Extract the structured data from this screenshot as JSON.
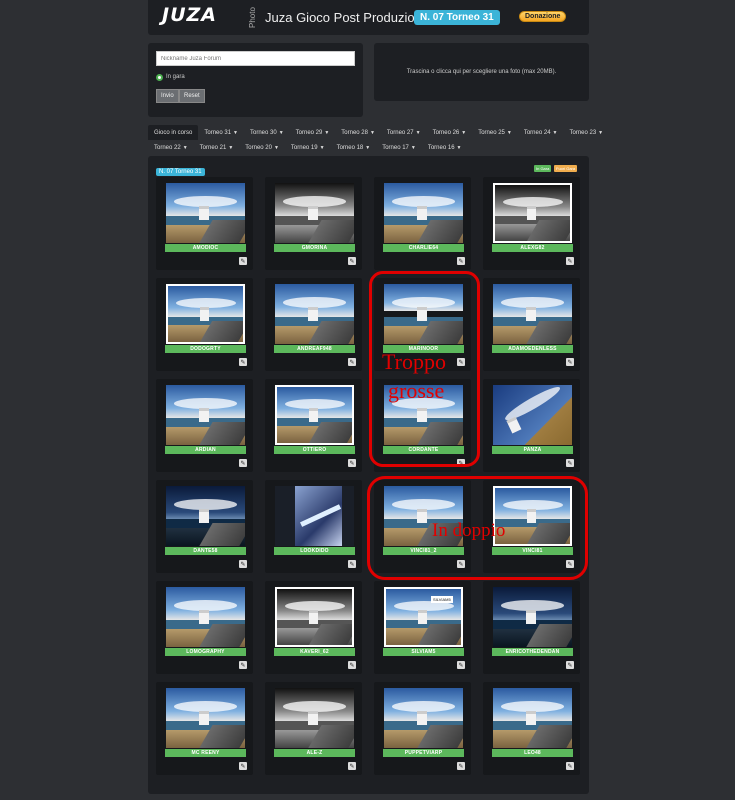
{
  "header": {
    "logo": "JUZA",
    "logo_sub": "Photo",
    "title": "Juza Gioco Post Produzione",
    "badge": "N. 07 Torneo 31",
    "donate": "Donazione"
  },
  "form": {
    "nickname_placeholder": "Nickname Juza Forum",
    "radio_label": "In gara",
    "send_label": "Invio",
    "reset_label": "Reset"
  },
  "upload": {
    "text": "Trascina o clicca qui per scegliere una foto (max 20MB)."
  },
  "tabs_row1": [
    "Gioco in corso",
    "Torneo 31",
    "Torneo 30",
    "Torneo 29",
    "Torneo 28",
    "Torneo 27",
    "Torneo 26",
    "Torneo 25",
    "Torneo 24",
    "Torneo 23"
  ],
  "tabs_row2": [
    "Torneo 22",
    "Torneo 21",
    "Torneo 20",
    "Torneo 19",
    "Torneo 18",
    "Torneo 17",
    "Torneo 16"
  ],
  "grid": {
    "badge": "N. 07 Torneo 31",
    "legend_in_gara": "In Gara",
    "legend_fuori_gara": "Fuori Gara"
  },
  "entries": [
    {
      "name": "AMODIOC",
      "style": "color"
    },
    {
      "name": "GMORINA",
      "style": "bw"
    },
    {
      "name": "CHARLIE64",
      "style": "color"
    },
    {
      "name": "ALEXG82",
      "style": "bw framed"
    },
    {
      "name": "DODOGRTY",
      "style": "color framed"
    },
    {
      "name": "ANDREAF948",
      "style": "color"
    },
    {
      "name": "MARINOOR",
      "style": "color pano"
    },
    {
      "name": "ADAMOEDENLESS",
      "style": "color"
    },
    {
      "name": "ARDIAN",
      "style": "color"
    },
    {
      "name": "OTTIERO",
      "style": "color framed"
    },
    {
      "name": "CORDANTE",
      "style": "color"
    },
    {
      "name": "PANZA",
      "style": "tilt"
    },
    {
      "name": "DANTE58",
      "style": "dark"
    },
    {
      "name": "LOOKDIDO",
      "style": "abstract"
    },
    {
      "name": "VINCI81_2",
      "style": "color"
    },
    {
      "name": "VINCI81",
      "style": "color framed"
    },
    {
      "name": "LOMOGRAPHY",
      "style": "color"
    },
    {
      "name": "KAVERI_62",
      "style": "bw framed"
    },
    {
      "name": "SILVIAM5",
      "style": "color framed",
      "label": "SILVIAM5"
    },
    {
      "name": "ENRICOTHEDENDAN",
      "style": "dark"
    },
    {
      "name": "MC REENY",
      "style": "color"
    },
    {
      "name": "ALE-Z",
      "style": "bw"
    },
    {
      "name": "PUPPETVIARP",
      "style": "color"
    },
    {
      "name": "LEO48",
      "style": "color"
    }
  ],
  "annotations": {
    "big_text_1": "Troppo",
    "big_text_2": "grosse",
    "double_text": "In doppio",
    "color": "#e00000"
  },
  "colors": {
    "background": "#2d2f33",
    "panel": "#1d1f23",
    "accent_blue": "#3bb4d8",
    "green": "#5cb85c",
    "orange": "#f0ad4e"
  }
}
